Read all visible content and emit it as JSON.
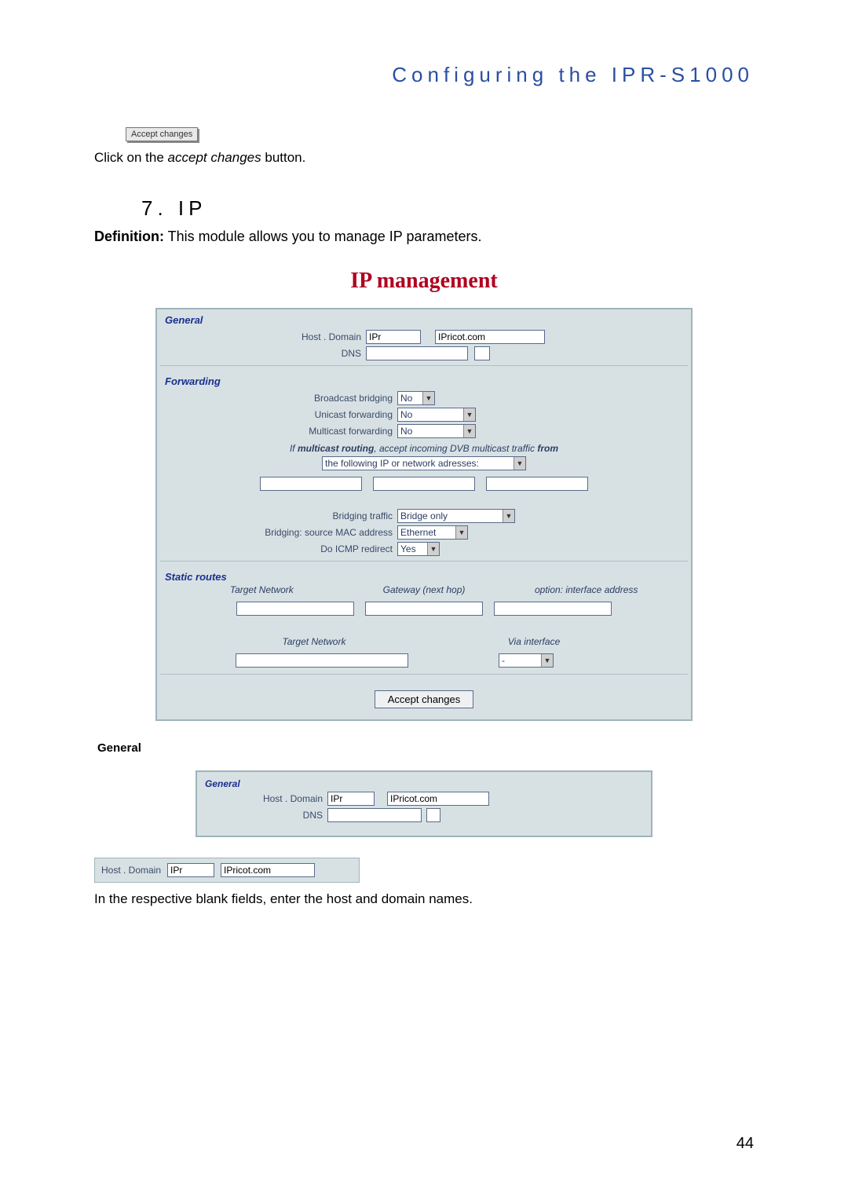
{
  "header": {
    "title": "Configuring the IPR-S1000"
  },
  "intro": {
    "accept_chip": "Accept changes",
    "sentence_pre": "Click on the ",
    "sentence_em": "accept changes",
    "sentence_post": " button."
  },
  "section": {
    "number_label": "7. IP",
    "definition_label": "Definition:",
    "definition_text": " This module allows you to manage IP parameters."
  },
  "panel": {
    "title": "IP management",
    "general": {
      "heading": "General",
      "host_domain_label": "Host . Domain",
      "host_value": "IPr",
      "domain_value": "IPricot.com",
      "dns_label": "DNS",
      "dns_value": ""
    },
    "forwarding": {
      "heading": "Forwarding",
      "broadcast_label": "Broadcast bridging",
      "broadcast_value": "No",
      "unicast_label": "Unicast forwarding",
      "unicast_value": "No",
      "multicast_label": "Multicast forwarding",
      "multicast_value": "No",
      "note_pre": "If ",
      "note_em": "multicast routing",
      "note_mid": ", accept incoming DVB multicast traffic ",
      "note_strong": "from",
      "dropdown_label": "the following IP or network adresses:",
      "bridging_traffic_label": "Bridging traffic",
      "bridging_traffic_value": "Bridge only",
      "bridging_mac_label": "Bridging: source MAC address",
      "bridging_mac_value": "Ethernet",
      "icmp_label": "Do ICMP redirect",
      "icmp_value": "Yes"
    },
    "static": {
      "heading": "Static routes",
      "col_target": "Target Network",
      "col_gateway": "Gateway (next hop)",
      "col_option": "option: interface address",
      "col_target2": "Target Network",
      "col_via": "Via interface",
      "via_value": "-"
    },
    "accept_button": "Accept changes"
  },
  "general_sub": {
    "heading": "General",
    "panel_heading": "General",
    "host_domain_label": "Host . Domain",
    "host_value": "IPr",
    "domain_value": "IPricot.com",
    "dns_label": "DNS"
  },
  "strip": {
    "label": "Host . Domain",
    "host_value": "IPr",
    "domain_value": "IPricot.com"
  },
  "closing": "In the respective blank fields, enter the host and domain names.",
  "page_number": "44"
}
